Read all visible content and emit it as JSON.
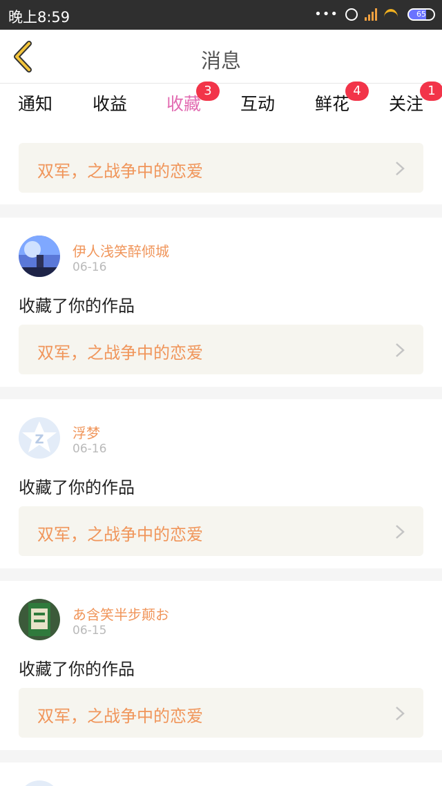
{
  "status_bar": {
    "time": "晚上8:59",
    "dots": "•••",
    "battery": "65"
  },
  "header": {
    "title": "消息",
    "back_icon": "chevron-left-icon"
  },
  "tabs": [
    {
      "label": "通知",
      "badge": ""
    },
    {
      "label": "收益",
      "badge": ""
    },
    {
      "label": "收藏",
      "badge": "3",
      "active": true
    },
    {
      "label": "互动",
      "badge": ""
    },
    {
      "label": "鲜花",
      "badge": "4"
    },
    {
      "label": "关注",
      "badge": "1"
    }
  ],
  "feed": {
    "partial_top": {
      "work_title": "双军，之战争中的恋爱"
    },
    "items": [
      {
        "username": "伊人浅笑醉倾城",
        "date": "06-16",
        "action": "收藏了你的作品",
        "work_title": "双军，之战争中的恋爱",
        "avatar": "anime-avatar"
      },
      {
        "username": "浮梦",
        "date": "06-16",
        "action": "收藏了你的作品",
        "work_title": "双军，之战争中的恋爱",
        "avatar": "default-z-avatar"
      },
      {
        "username": "あ含笑半步颠お",
        "date": "06-15",
        "action": "收藏了你的作品",
        "work_title": "双军，之战争中的恋爱",
        "avatar": "green-label-avatar"
      }
    ]
  },
  "colors": {
    "accent_pink": "#e26bb1",
    "badge_red": "#f23449",
    "username_orange": "#f0955a",
    "back_yellow": "#f4c53c"
  }
}
